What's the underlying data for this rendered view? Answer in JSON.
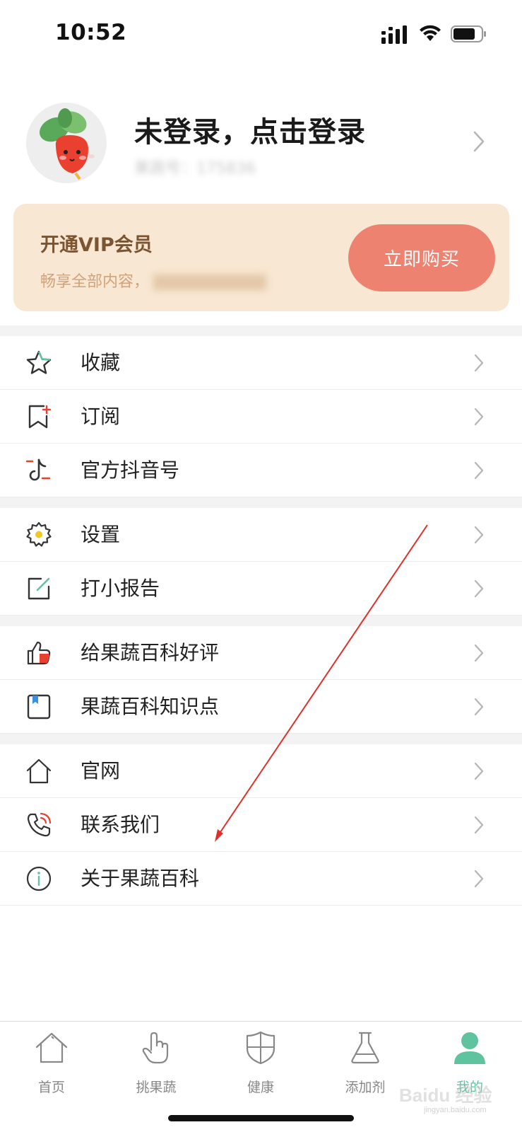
{
  "status_bar": {
    "time": "10:52"
  },
  "profile": {
    "title": "未登录，点击登录",
    "subtitle": "果蔬号：175836"
  },
  "vip": {
    "title": "开通VIP会员",
    "subtitle": "畅享全部内容，",
    "buy_label": "立即购买"
  },
  "menu": {
    "groups": [
      [
        {
          "label": "收藏",
          "icon": "star-icon"
        },
        {
          "label": "订阅",
          "icon": "bookmark-plus-icon"
        },
        {
          "label": "官方抖音号",
          "icon": "tiktok-icon"
        }
      ],
      [
        {
          "label": "设置",
          "icon": "gear-icon"
        },
        {
          "label": "打小报告",
          "icon": "edit-icon"
        }
      ],
      [
        {
          "label": "给果蔬百科好评",
          "icon": "thumbs-up-icon"
        },
        {
          "label": "果蔬百科知识点",
          "icon": "book-icon"
        }
      ],
      [
        {
          "label": "官网",
          "icon": "home-outline-icon"
        },
        {
          "label": "联系我们",
          "icon": "phone-icon"
        },
        {
          "label": "关于果蔬百科",
          "icon": "info-icon"
        }
      ]
    ]
  },
  "tabbar": {
    "tabs": [
      {
        "label": "首页",
        "icon": "home-icon"
      },
      {
        "label": "挑果蔬",
        "icon": "hand-pointer-icon"
      },
      {
        "label": "健康",
        "icon": "shield-icon"
      },
      {
        "label": "添加剂",
        "icon": "flask-icon"
      },
      {
        "label": "我的",
        "icon": "user-icon"
      }
    ],
    "active_index": 4
  },
  "colors": {
    "accent_green": "#5fc3a0",
    "vip_background": "#f8e7d2",
    "buy_button": "#ee8271",
    "annotation_arrow": "#e0302a"
  },
  "watermark": {
    "brand": "Baidu 经验",
    "url": "jingyan.baidu.com"
  }
}
